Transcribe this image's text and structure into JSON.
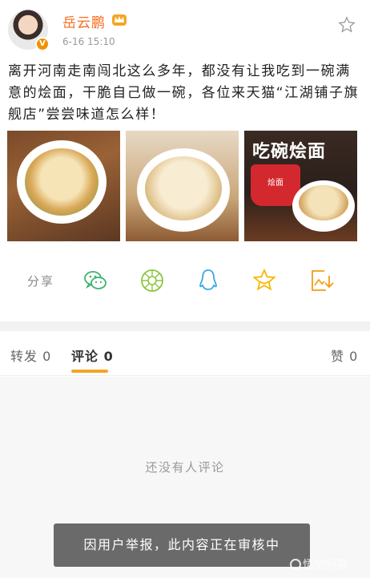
{
  "header": {
    "user_name": "岳云鹏",
    "post_time": "6-16 15:10"
  },
  "post": {
    "text": "离开河南走南闯北这么多年，都没有让我吃到一碗满意的烩面，干脆自己做一碗，各位来天猫“江湖铺子旗舰店”尝尝味道怎么样！",
    "image3_title": "吃碗烩面",
    "image3_cup_label": "烩面"
  },
  "share": {
    "label": "分享"
  },
  "tabs": [
    {
      "label": "转发 0"
    },
    {
      "label": "评论 0"
    },
    {
      "label": "赞 0"
    }
  ],
  "comments": {
    "empty_text": "还没有人评论"
  },
  "toast": {
    "text": "因用户举报，此内容正在审核中"
  },
  "watermark": {
    "text": "悟空问答"
  },
  "colors": {
    "accent": "#f5a623",
    "username": "#f86b1c",
    "wechat": "#39b36c",
    "moments": "#8dc63f",
    "qq": "#3aa7e6",
    "favorite": "#f5b800",
    "save": "#f39c12"
  }
}
